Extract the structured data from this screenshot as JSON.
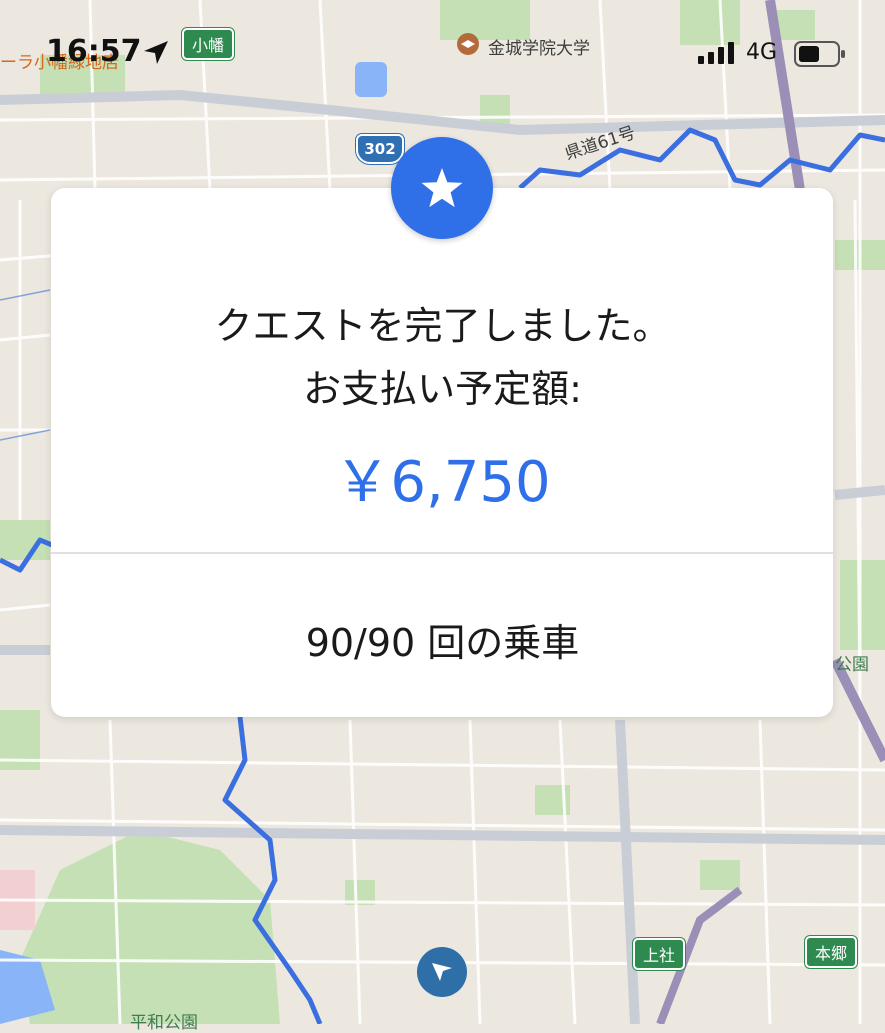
{
  "status_bar": {
    "time": "16:57",
    "network": "4G",
    "icons": [
      "location-arrow-icon",
      "signal-bars-icon",
      "battery-icon"
    ]
  },
  "map": {
    "labels": {
      "top_left": "ーラ小幡緑地店",
      "university": "金城学院大学",
      "road": "県道61号",
      "park_right": "公園",
      "park_bottom": "平和公園"
    },
    "stations": {
      "obata": "小幡",
      "kamiyashiro": "上社",
      "hongo": "本郷"
    },
    "route_number": "302"
  },
  "card": {
    "message_line1": "クエストを完了しました。",
    "message_line2": "お支払い予定額:",
    "amount": "￥6,750",
    "rides": "90/90 回の乗車",
    "badge_icon": "star-icon"
  },
  "colors": {
    "accent": "#2f6fe8",
    "route_line": "#2f6fe8",
    "station_green": "#2e8a4e",
    "map_background": "#ece8df"
  }
}
